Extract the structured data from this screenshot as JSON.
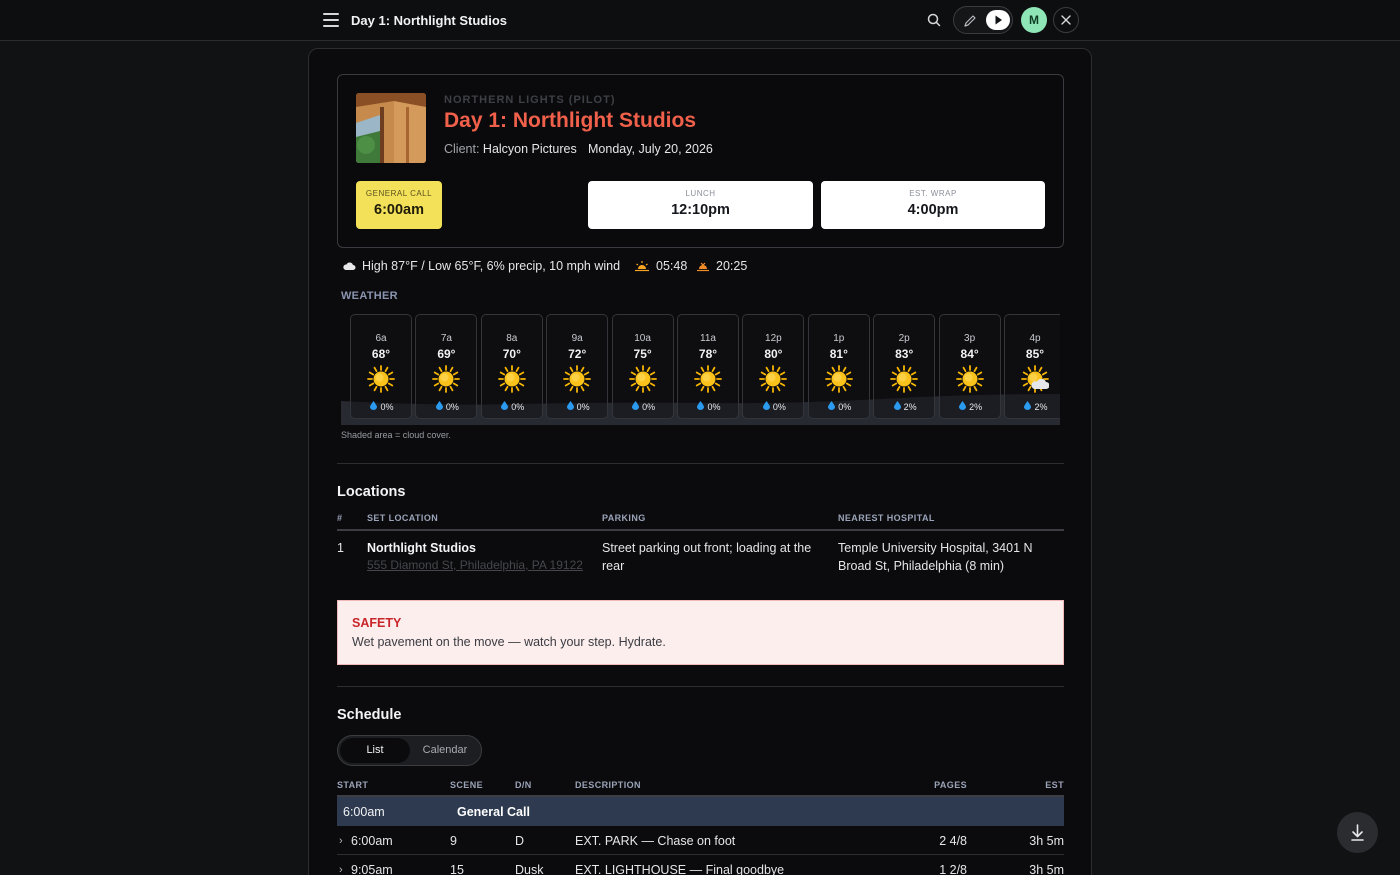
{
  "topbar": {
    "title": "Day 1: Northlight Studios",
    "avatar_initial": "M"
  },
  "header": {
    "project": "NORTHERN LIGHTS (PILOT)",
    "title": "Day 1: Northlight Studios",
    "client_label": "Client:",
    "client": "Halcyon Pictures",
    "date": "Monday, July 20, 2026"
  },
  "times": {
    "general_call": {
      "label": "GENERAL CALL",
      "value": "6:00am"
    },
    "lunch": {
      "label": "LUNCH",
      "value": "12:10pm"
    },
    "wrap": {
      "label": "EST. WRAP",
      "value": "4:00pm"
    }
  },
  "weather": {
    "summary": "High 87°F / Low 65°F, 6% precip, 10 mph wind",
    "sunrise": "05:48",
    "sunset": "20:25",
    "section_label": "WEATHER",
    "note": "Shaded area = cloud cover.",
    "hours": [
      {
        "hour": "6a",
        "temp": "68°",
        "precip": "0%",
        "icon": "sun-icon"
      },
      {
        "hour": "7a",
        "temp": "69°",
        "precip": "0%",
        "icon": "sun-icon"
      },
      {
        "hour": "8a",
        "temp": "70°",
        "precip": "0%",
        "icon": "sun-icon"
      },
      {
        "hour": "9a",
        "temp": "72°",
        "precip": "0%",
        "icon": "sun-icon"
      },
      {
        "hour": "10a",
        "temp": "75°",
        "precip": "0%",
        "icon": "sun-icon"
      },
      {
        "hour": "11a",
        "temp": "78°",
        "precip": "0%",
        "icon": "sun-icon"
      },
      {
        "hour": "12p",
        "temp": "80°",
        "precip": "0%",
        "icon": "sun-icon"
      },
      {
        "hour": "1p",
        "temp": "81°",
        "precip": "0%",
        "icon": "sun-icon"
      },
      {
        "hour": "2p",
        "temp": "83°",
        "precip": "2%",
        "icon": "sun-icon"
      },
      {
        "hour": "3p",
        "temp": "84°",
        "precip": "2%",
        "icon": "sun-icon"
      },
      {
        "hour": "4p",
        "temp": "85°",
        "precip": "2%",
        "icon": "partly-cloudy-icon"
      }
    ]
  },
  "locations": {
    "title": "Locations",
    "headers": {
      "num": "#",
      "set": "SET LOCATION",
      "parking": "PARKING",
      "hospital": "NEAREST HOSPITAL"
    },
    "rows": [
      {
        "num": "1",
        "name": "Northlight Studios",
        "address": "555 Diamond St, Philadelphia, PA 19122",
        "parking": "Street parking out front; loading at the rear",
        "hospital": "Temple University Hospital, 3401 N Broad St, Philadelphia (8 min)"
      }
    ]
  },
  "safety": {
    "title": "SAFETY",
    "message": "Wet pavement on the move — watch your step. Hydrate."
  },
  "schedule": {
    "title": "Schedule",
    "views": [
      "List",
      "Calendar"
    ],
    "active_view": "List",
    "headers": {
      "start": "START",
      "scene": "SCENE",
      "dn": "D/N",
      "description": "DESCRIPTION",
      "pages": "PAGES",
      "est": "EST"
    },
    "general_call": {
      "time": "6:00am",
      "label": "General Call"
    },
    "rows": [
      {
        "start": "6:00am",
        "scene": "9",
        "dn": "D",
        "description": "EXT. PARK — Chase on foot",
        "pages": "2 4/8",
        "est": "3h 5m"
      },
      {
        "start": "9:05am",
        "scene": "15",
        "dn": "Dusk",
        "description": "EXT. LIGHTHOUSE — Final goodbye",
        "pages": "1 2/8",
        "est": "3h 5m"
      }
    ]
  },
  "colors": {
    "accent": "#f0604a",
    "general_call_bg": "#f4e15a",
    "safety_bg": "#fdeeee",
    "safety_text": "#c8262b",
    "avatar_bg": "#8ee6b7"
  }
}
